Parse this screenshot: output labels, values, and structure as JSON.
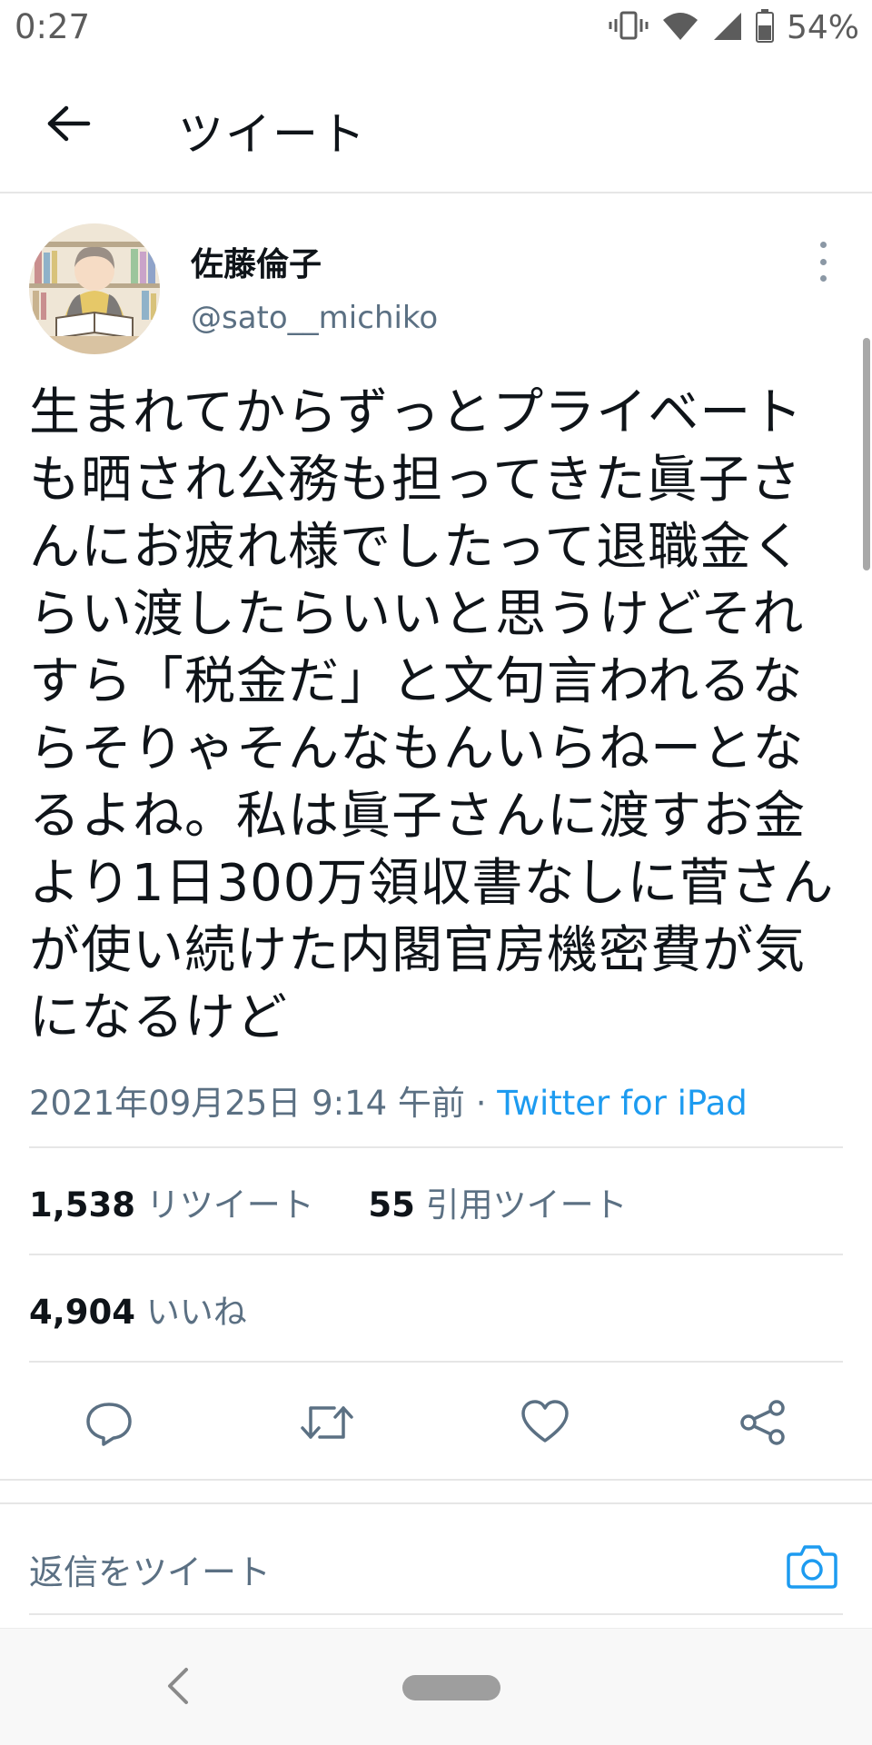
{
  "status_bar": {
    "time": "0:27",
    "battery_percent": "54%",
    "icons": [
      "vibrate-icon",
      "wifi-icon",
      "signal-icon",
      "battery-icon"
    ]
  },
  "header": {
    "title": "ツイート",
    "back_icon": "arrow-left-icon"
  },
  "tweet": {
    "author": {
      "name": "佐藤倫子",
      "handle": "@sato__michiko"
    },
    "text": "生まれてからずっとプライベートも晒され公務も担ってきた眞子さんにお疲れ様でしたって退職金くらい渡したらいいと思うけどそれすら「税金だ」と文句言われるならそりゃそんなもんいらねーとなるよね。私は眞子さんに渡すお金より1日300万領収書なしに菅さんが使い続けた内閣官房機密費が気になるけど",
    "date": "2021年09月25日 9:14 午前",
    "separator": "·",
    "source": "Twitter for iPad",
    "stats": {
      "retweets_count": "1,538",
      "retweets_label": "リツイート",
      "quotes_count": "55",
      "quotes_label": "引用ツイート",
      "likes_count": "4,904",
      "likes_label": "いいね"
    },
    "actions": [
      "reply-icon",
      "retweet-icon",
      "like-icon",
      "share-icon"
    ]
  },
  "reply_box": {
    "placeholder": "返信をツイート",
    "camera_icon": "camera-icon"
  },
  "colors": {
    "text_primary": "#0f1419",
    "text_secondary": "#5b7083",
    "accent": "#1d9bf0",
    "divider": "#e6e6e6"
  }
}
